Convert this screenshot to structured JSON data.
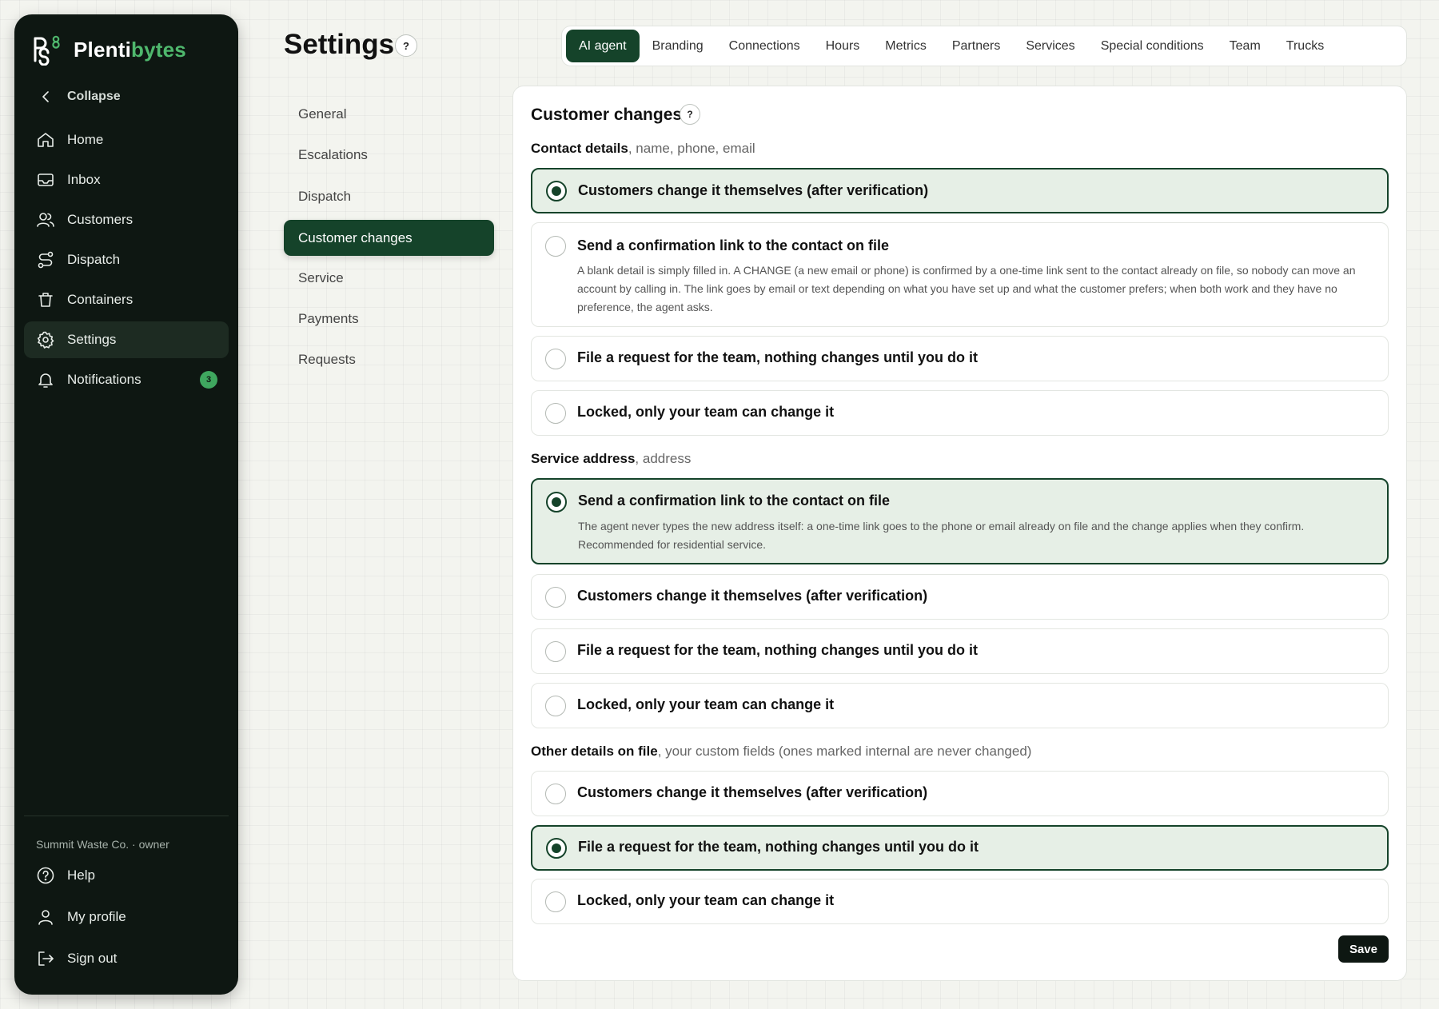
{
  "brand": {
    "prefix": "Plenti",
    "accent": "bytes",
    "logo_icon": "plentibytes-logo",
    "accent_color": "#4fb86d"
  },
  "sidebar": {
    "collapse_label": "Collapse",
    "items": [
      {
        "label": "Home",
        "icon": "home-icon"
      },
      {
        "label": "Inbox",
        "icon": "inbox-icon"
      },
      {
        "label": "Customers",
        "icon": "users-icon"
      },
      {
        "label": "Dispatch",
        "icon": "route-icon"
      },
      {
        "label": "Containers",
        "icon": "trash-icon"
      },
      {
        "label": "Settings",
        "icon": "gear-icon",
        "active": true
      },
      {
        "label": "Notifications",
        "icon": "bell-icon",
        "badge": "3"
      }
    ],
    "org_line": "Summit Waste Co. · owner",
    "footer": [
      {
        "label": "Help",
        "icon": "help-icon"
      },
      {
        "label": "My profile",
        "icon": "user-icon"
      },
      {
        "label": "Sign out",
        "icon": "sign-out-icon"
      }
    ]
  },
  "header": {
    "title": "Settings",
    "help_glyph": "?",
    "tabs": [
      "AI agent",
      "Branding",
      "Connections",
      "Hours",
      "Metrics",
      "Partners",
      "Services",
      "Special conditions",
      "Team",
      "Trucks"
    ],
    "active_tab": "AI agent"
  },
  "subnav": {
    "items": [
      "General",
      "Escalations",
      "Dispatch",
      "Customer changes",
      "Service",
      "Payments",
      "Requests"
    ],
    "active": "Customer changes"
  },
  "card": {
    "title": "Customer changes",
    "help_glyph": "?",
    "groups": [
      {
        "label_bold": "Contact details",
        "label_rest": ", name, phone, email",
        "options": [
          {
            "title": "Customers change it themselves (after verification)",
            "selected": true
          },
          {
            "title": "Send a confirmation link to the contact on file",
            "desc": "A blank detail is simply filled in. A CHANGE (a new email or phone) is confirmed by a one-time link sent to the contact already on file, so nobody can move an account by calling in. The link goes by email or text depending on what you have set up and what the customer prefers; when both work and they have no preference, the agent asks."
          },
          {
            "title": "File a request for the team, nothing changes until you do it"
          },
          {
            "title": "Locked, only your team can change it"
          }
        ]
      },
      {
        "label_bold": "Service address",
        "label_rest": ", address",
        "options": [
          {
            "title": "Send a confirmation link to the contact on file",
            "desc": "The agent never types the new address itself: a one-time link goes to the phone or email already on file and the change applies when they confirm. Recommended for residential service.",
            "selected": true
          },
          {
            "title": "Customers change it themselves (after verification)"
          },
          {
            "title": "File a request for the team, nothing changes until you do it"
          },
          {
            "title": "Locked, only your team can change it"
          }
        ]
      },
      {
        "label_bold": "Other details on file",
        "label_rest": ", your custom fields (ones marked internal are never changed)",
        "options": [
          {
            "title": "Customers change it themselves (after verification)"
          },
          {
            "title": "File a request for the team, nothing changes until you do it",
            "selected": true
          },
          {
            "title": "Locked, only your team can change it"
          }
        ]
      }
    ],
    "save_label": "Save"
  },
  "colors": {
    "primary": "#15432a",
    "sidebar_bg": "#0e1712",
    "selected_bg": "#e6efe6",
    "badge": "#3fa75f"
  }
}
